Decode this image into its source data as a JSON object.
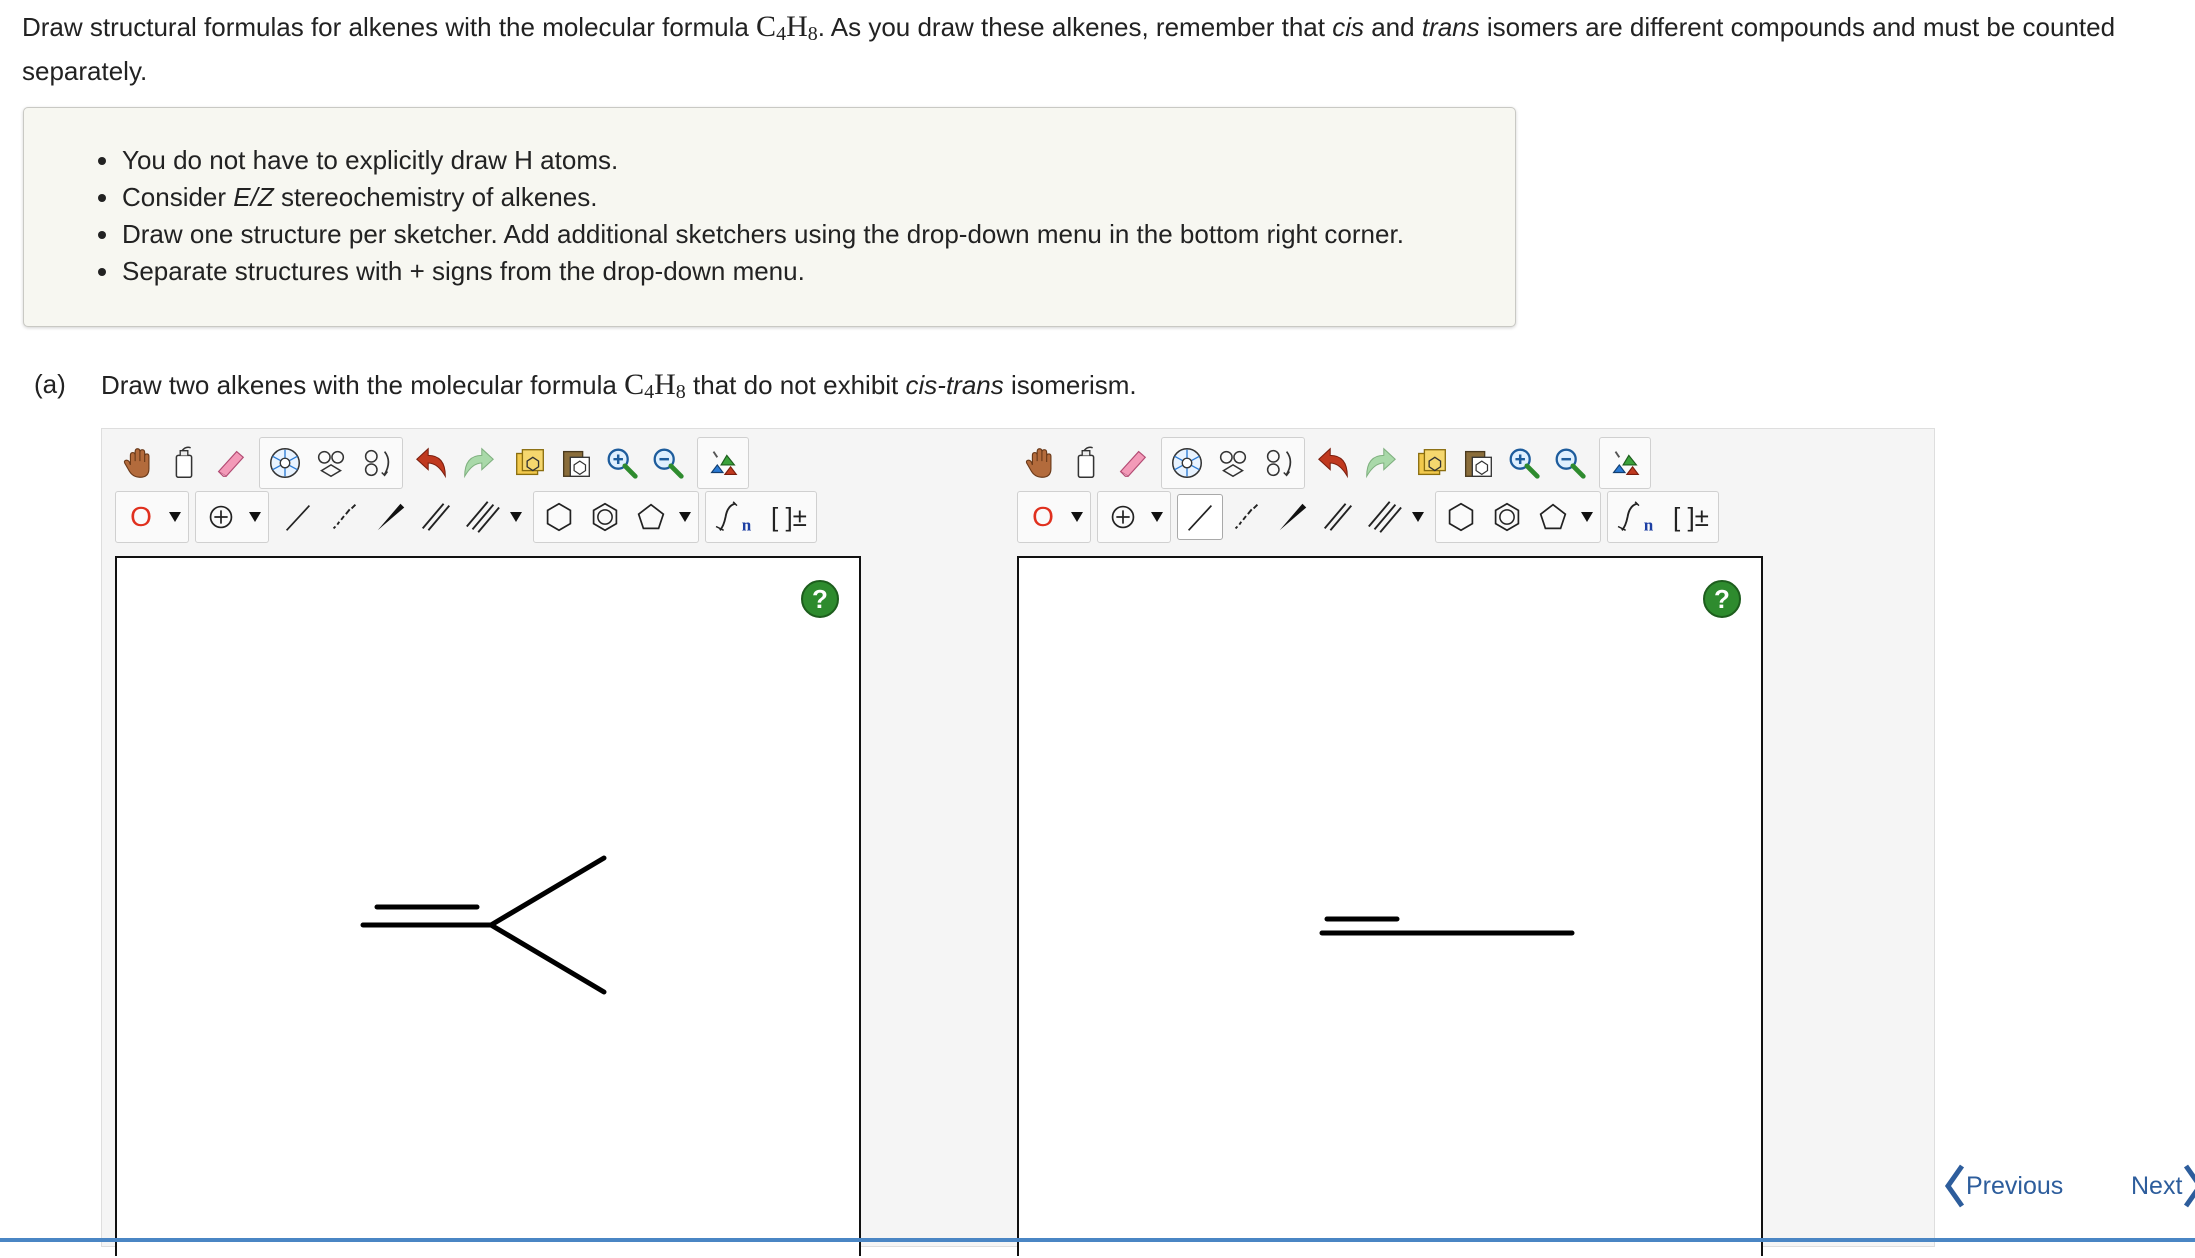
{
  "instructions": {
    "prefix": "Draw structural formulas for alkenes with the molecular formula ",
    "formula_c": "C",
    "formula_c_sub": "4",
    "formula_h": "H",
    "formula_h_sub": "8",
    "mid": ". As you draw these alkenes, remember that ",
    "cis": "cis",
    "and": " and ",
    "trans": "trans",
    "suffix": " isomers are different compounds and must be counted separately."
  },
  "notes": {
    "item1": "You do not have to explicitly draw H atoms.",
    "item2_prefix": "Consider ",
    "item2_em": "E/Z",
    "item2_suffix": " stereochemistry of alkenes.",
    "item3": "Draw one structure per sketcher. Add additional sketchers using the drop-down menu in the bottom right corner.",
    "item4": "Separate structures with + signs from the drop-down menu."
  },
  "question": {
    "label": "(a)",
    "prefix": "Draw two alkenes with the molecular formula ",
    "formula_c": "C",
    "formula_c_sub": "4",
    "formula_h": "H",
    "formula_h_sub": "8",
    "mid": " that do not exhibit ",
    "em": "cis-trans",
    "suffix": " isomerism."
  },
  "sketcher": {
    "atom_label": "O",
    "help_label": "?",
    "bracket_label": "[ ]±",
    "sgroup_label": "n",
    "icons": [
      "hand-icon",
      "clear-icon",
      "eraser-icon",
      "template-icon",
      "ring-template-icon",
      "rotate-icon",
      "undo-icon",
      "redo-icon",
      "copy-icon",
      "paste-icon",
      "zoom-in-icon",
      "zoom-out-icon",
      "clean-icon",
      "charge-icon",
      "single-bond-icon",
      "dashed-bond-icon",
      "wedge-bond-icon",
      "double-bond-icon",
      "triple-bond-icon",
      "benzene-icon",
      "cyclohexane-icon",
      "cyclopentane-icon",
      "sgroup-icon",
      "bracket-icon",
      "help-icon"
    ]
  },
  "navigation": {
    "previous": "Previous",
    "next": "Next"
  },
  "colors": {
    "accent": "#2d5d9c",
    "help_green": "#2e8b2e",
    "atom_red": "#e0301e",
    "note_bg": "#f7f7f1"
  }
}
